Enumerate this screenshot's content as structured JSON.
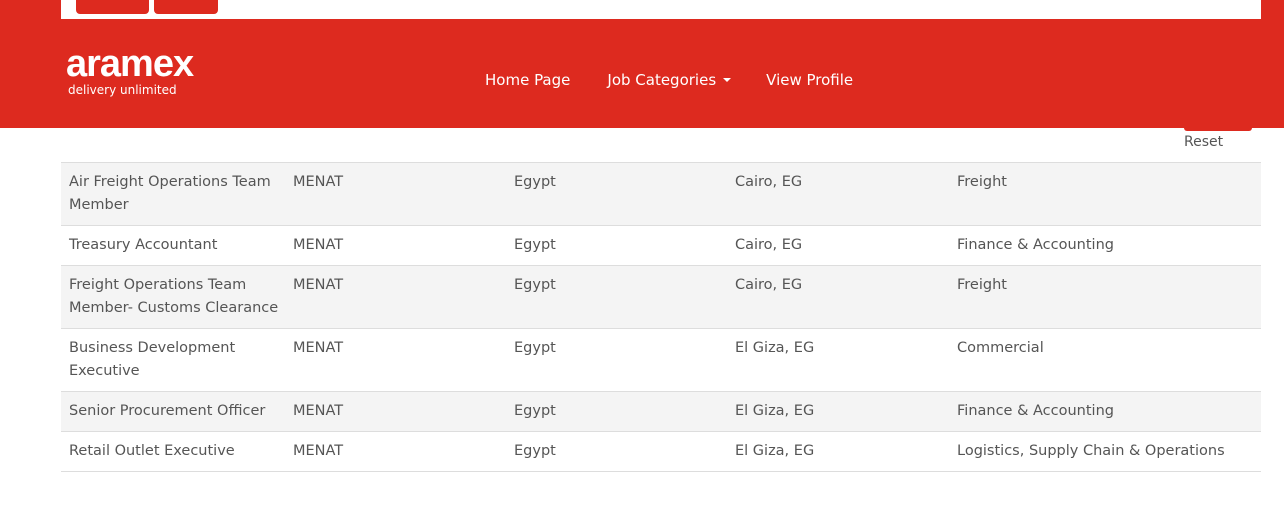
{
  "brand": {
    "name": "aramex",
    "tagline": "delivery unlimited",
    "accent_color": "#dd2a1f"
  },
  "nav": {
    "home": "Home Page",
    "job_categories": "Job Categories",
    "view_profile": "View Profile"
  },
  "filters": {
    "reset_label": "Reset"
  },
  "jobs": [
    {
      "title": "Air Freight Operations Team Member",
      "region": "MENAT",
      "country": "Egypt",
      "city": "Cairo, EG",
      "category": "Freight"
    },
    {
      "title": "Treasury Accountant",
      "region": "MENAT",
      "country": "Egypt",
      "city": "Cairo, EG",
      "category": "Finance & Accounting"
    },
    {
      "title": "Freight Operations Team Member- Customs Clearance",
      "region": "MENAT",
      "country": "Egypt",
      "city": "Cairo, EG",
      "category": "Freight"
    },
    {
      "title": "Business Development Executive",
      "region": "MENAT",
      "country": "Egypt",
      "city": "El Giza, EG",
      "category": "Commercial"
    },
    {
      "title": "Senior Procurement Officer",
      "region": "MENAT",
      "country": "Egypt",
      "city": "El Giza, EG",
      "category": "Finance & Accounting"
    },
    {
      "title": "Retail Outlet Executive",
      "region": "MENAT",
      "country": "Egypt",
      "city": "El Giza, EG",
      "category": "Logistics, Supply Chain & Operations"
    }
  ]
}
